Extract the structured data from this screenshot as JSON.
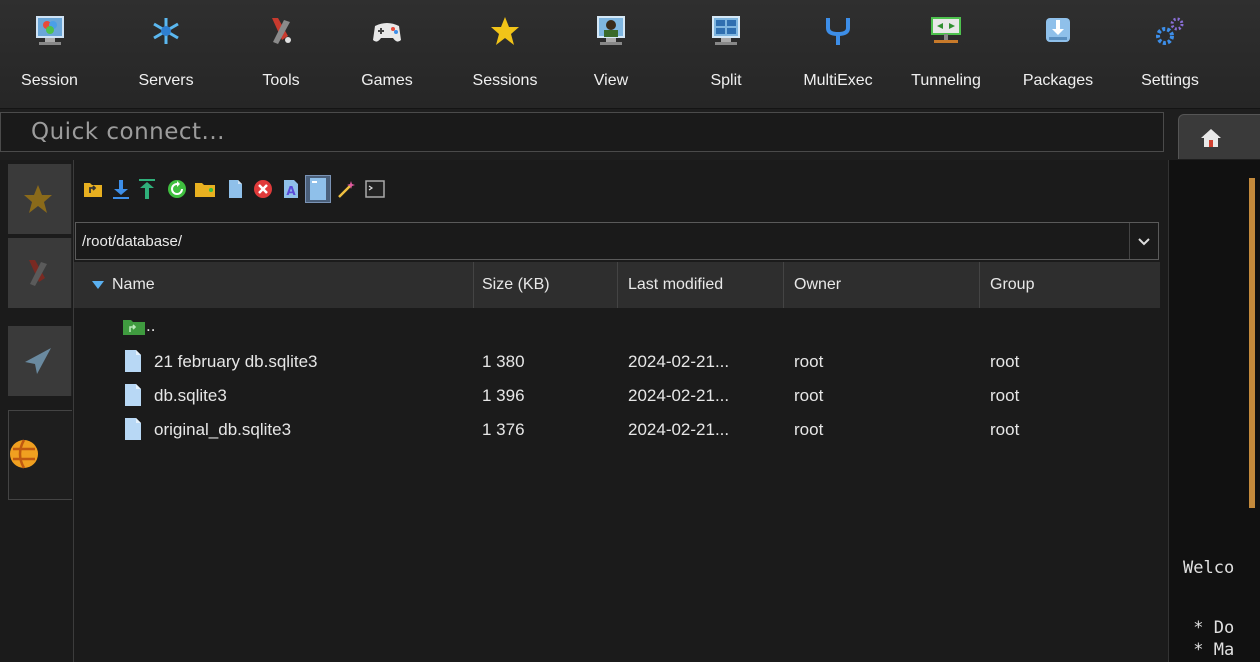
{
  "menu": [
    {
      "label": "Session",
      "icon": "session-icon"
    },
    {
      "label": "Servers",
      "icon": "servers-icon"
    },
    {
      "label": "Tools",
      "icon": "tools-icon"
    },
    {
      "label": "Games",
      "icon": "gamepad-icon"
    },
    {
      "label": "Sessions",
      "icon": "star-icon"
    },
    {
      "label": "View",
      "icon": "view-icon"
    },
    {
      "label": "Split",
      "icon": "split-icon"
    },
    {
      "label": "MultiExec",
      "icon": "multiexec-icon"
    },
    {
      "label": "Tunneling",
      "icon": "tunneling-icon"
    },
    {
      "label": "Packages",
      "icon": "packages-icon"
    },
    {
      "label": "Settings",
      "icon": "gears-icon"
    }
  ],
  "quick_connect": {
    "placeholder": "Quick connect..."
  },
  "sftp": {
    "path": "/root/database/",
    "columns": [
      "Name",
      "Size (KB)",
      "Last modified",
      "Owner",
      "Group"
    ],
    "parent_dir": "..",
    "files": [
      {
        "name": "21 february db.sqlite3",
        "size": "1 380",
        "modified": "2024-02-21...",
        "owner": "root",
        "group": "root"
      },
      {
        "name": "db.sqlite3",
        "size": "1 396",
        "modified": "2024-02-21...",
        "owner": "root",
        "group": "root"
      },
      {
        "name": "original_db.sqlite3",
        "size": "1 376",
        "modified": "2024-02-21...",
        "owner": "root",
        "group": "root"
      }
    ]
  },
  "terminal": {
    "line1": "Welco",
    "line2": " * Do",
    "line3": " * Ma"
  },
  "colors": {
    "accent": "#3d8ee8",
    "folder": "#3f9b3f"
  }
}
